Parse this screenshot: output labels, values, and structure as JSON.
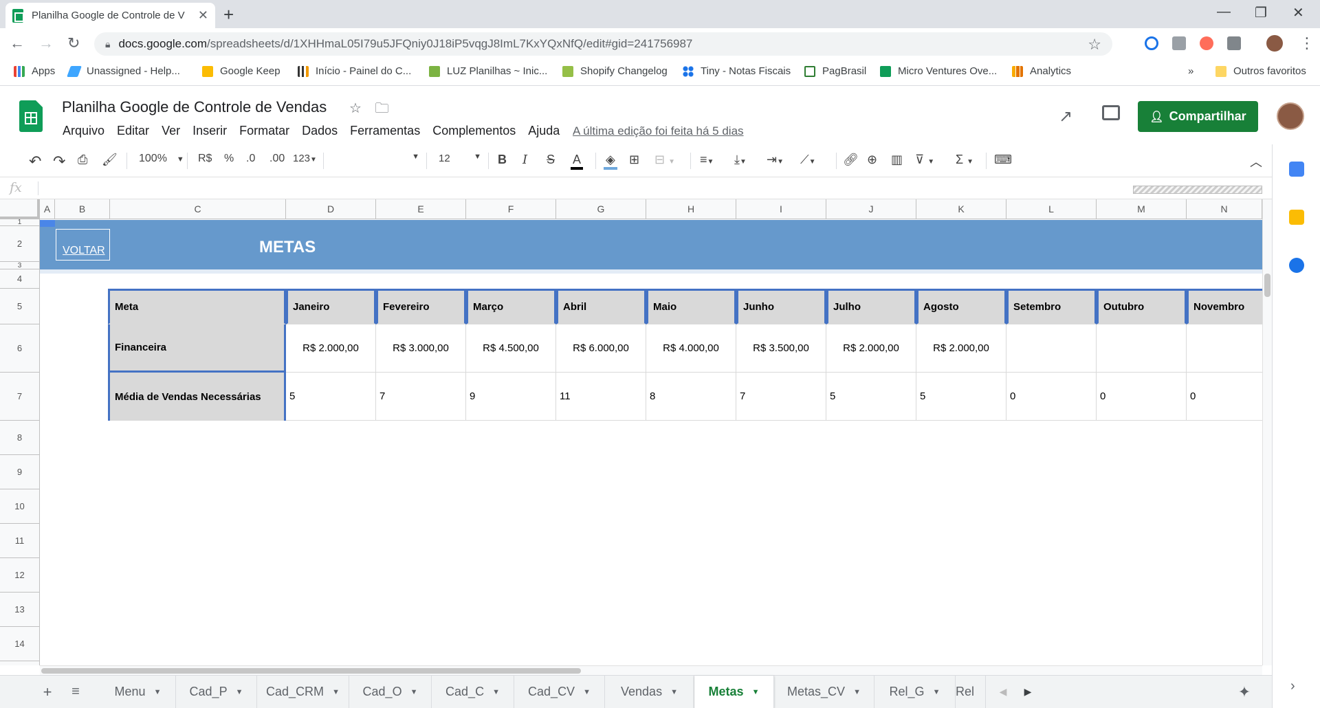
{
  "browser": {
    "tab_title": "Planilha Google de Controle de V",
    "url_host": "docs.google.com",
    "url_path": "/spreadsheets/d/1XHHmaL05I79u5JFQniy0J18iP5vqgJ8ImL7KxYQxNfQ/edit#gid=241756987",
    "bookmarks": [
      "Apps",
      "Unassigned - Help...",
      "Google Keep",
      "Início - Painel do C...",
      "LUZ Planilhas ~ Inic...",
      "Shopify Changelog",
      "Tiny - Notas Fiscais",
      "PagBrasil",
      "Micro Ventures Ove...",
      "Analytics"
    ],
    "more_bookmarks": "»",
    "other_favorites": "Outros favoritos"
  },
  "doc": {
    "title": "Planilha Google de Controle de Vendas",
    "menu": [
      "Arquivo",
      "Editar",
      "Ver",
      "Inserir",
      "Formatar",
      "Dados",
      "Ferramentas",
      "Complementos",
      "Ajuda"
    ],
    "last_edit": "A última edição foi feita há 5 dias",
    "share_label": "Compartilhar"
  },
  "toolbar": {
    "zoom": "100%",
    "currency": "R$",
    "percent": "%",
    "decimal_less": ".0",
    "decimal_more": ".00",
    "format_more": "123",
    "font_size": "12",
    "bold": "B",
    "italic": "I",
    "strike": "S",
    "text_color": "A"
  },
  "grid": {
    "columns": [
      "A",
      "B",
      "C",
      "D",
      "E",
      "F",
      "G",
      "H",
      "I",
      "J",
      "K",
      "L",
      "M",
      "N"
    ],
    "rows": [
      "1",
      "2",
      "3",
      "4",
      "5",
      "6",
      "7",
      "8",
      "9",
      "10",
      "11",
      "12",
      "13",
      "14"
    ],
    "back_link": "VOLTAR",
    "banner_title": "METAS"
  },
  "table": {
    "header_label": "Meta",
    "months": [
      "Janeiro",
      "Fevereiro",
      "Março",
      "Abril",
      "Maio",
      "Junho",
      "Julho",
      "Agosto",
      "Setembro",
      "Outubro",
      "Novembro"
    ],
    "row1_label": "Financeira",
    "row1_values": [
      "R$ 2.000,00",
      "R$ 3.000,00",
      "R$ 4.500,00",
      "R$ 6.000,00",
      "R$ 4.000,00",
      "R$ 3.500,00",
      "R$ 2.000,00",
      "R$ 2.000,00",
      "",
      "",
      ""
    ],
    "row2_label": "Média de Vendas Necessárias",
    "row2_values": [
      "5",
      "7",
      "9",
      "11",
      "8",
      "7",
      "5",
      "5",
      "0",
      "0",
      "0"
    ]
  },
  "sheet_tabs": [
    {
      "label": "Menu",
      "active": false
    },
    {
      "label": "Cad_P",
      "active": false
    },
    {
      "label": "Cad_CRM",
      "active": false
    },
    {
      "label": "Cad_O",
      "active": false
    },
    {
      "label": "Cad_C",
      "active": false
    },
    {
      "label": "Cad_CV",
      "active": false
    },
    {
      "label": "Vendas",
      "active": false
    },
    {
      "label": "Metas",
      "active": true
    },
    {
      "label": "Metas_CV",
      "active": false
    },
    {
      "label": "Rel_G",
      "active": false
    },
    {
      "label": "Rel",
      "active": false
    }
  ],
  "colors": {
    "banner": "#6699cc",
    "header_fill": "#d9d9d9",
    "table_border": "#4472c4",
    "share_button": "#188038"
  }
}
